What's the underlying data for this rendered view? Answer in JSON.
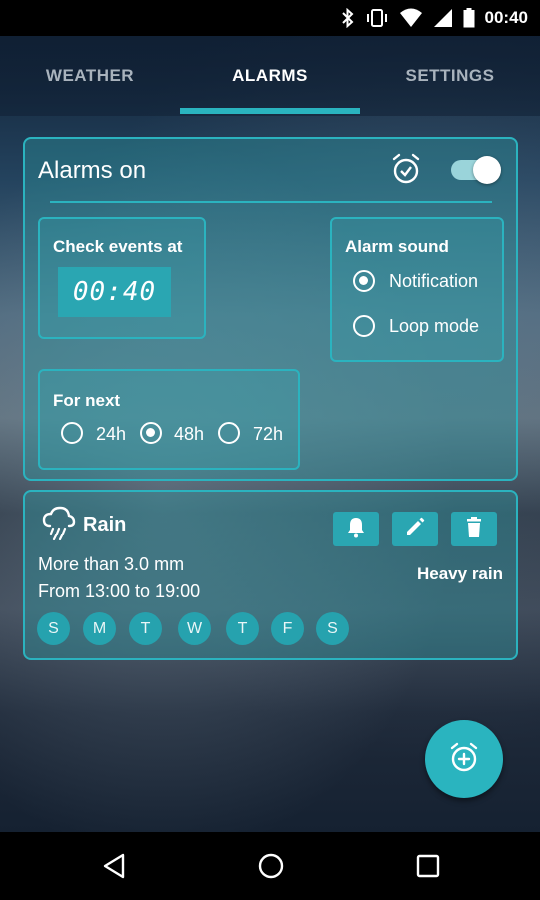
{
  "status_bar": {
    "time": "00:40"
  },
  "tabs": [
    {
      "label": "WEATHER"
    },
    {
      "label": "ALARMS"
    },
    {
      "label": "SETTINGS"
    }
  ],
  "alarms_card": {
    "title": "Alarms on",
    "toggle_on": true,
    "check_events": {
      "label": "Check events at",
      "time": "00:40"
    },
    "alarm_sound": {
      "label": "Alarm sound",
      "options": [
        {
          "label": "Notification",
          "selected": true
        },
        {
          "label": "Loop mode",
          "selected": false
        }
      ]
    },
    "for_next": {
      "label": "For next",
      "options": [
        {
          "label": "24h",
          "selected": false
        },
        {
          "label": "48h",
          "selected": true
        },
        {
          "label": "72h",
          "selected": false
        }
      ]
    }
  },
  "rain_card": {
    "title": "Rain",
    "condition": "More than 3.0 mm",
    "time_range": "From 13:00 to 19:00",
    "intensity": "Heavy rain",
    "days": [
      "S",
      "M",
      "T",
      "W",
      "T",
      "F",
      "S"
    ]
  },
  "colors": {
    "accent": "#2ab4bf",
    "status_bar": "#000000",
    "nav_bar": "#000000"
  },
  "icons": {
    "card_alarm": "alarm-check-icon",
    "rain": "rain-cloud-icon",
    "fab": "add-alarm-icon"
  }
}
